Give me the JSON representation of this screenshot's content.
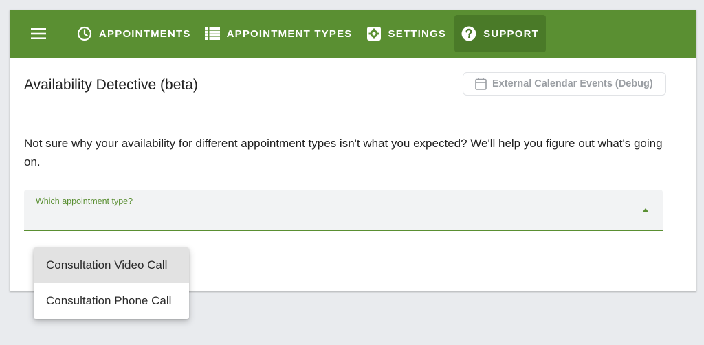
{
  "nav": {
    "menu_icon": "hamburger-icon",
    "items": [
      {
        "label": "APPOINTMENTS",
        "icon": "clock-icon"
      },
      {
        "label": "APPOINTMENT TYPES",
        "icon": "list-icon"
      },
      {
        "label": "SETTINGS",
        "icon": "gear-icon"
      },
      {
        "label": "SUPPORT",
        "icon": "question-icon",
        "active": true
      }
    ],
    "color": "#5a8f32"
  },
  "page": {
    "title": "Availability Detective (beta)",
    "debug_button": {
      "label": "External Calendar Events (Debug)",
      "icon": "calendar-icon"
    },
    "description": "Not sure why your availability for different appointment types isn't what you expected? We'll help you figure out what's going on."
  },
  "select": {
    "label": "Which appointment type?",
    "value": "",
    "options": [
      {
        "label": "Consultation Video Call",
        "highlighted": true
      },
      {
        "label": "Consultation Phone Call"
      }
    ]
  }
}
